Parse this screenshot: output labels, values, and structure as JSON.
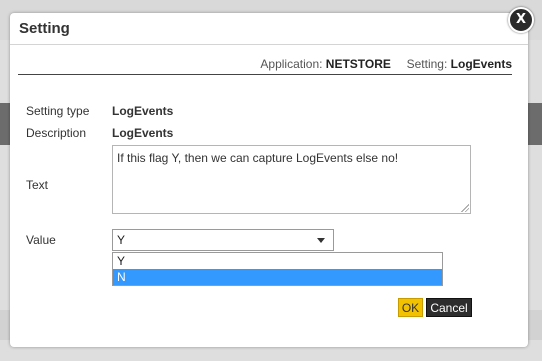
{
  "dialog": {
    "title": "Setting",
    "close_glyph": "X",
    "close_icon": "close-icon"
  },
  "context": {
    "application_label": "Application:",
    "application_value": "NETSTORE",
    "setting_label": "Setting:",
    "setting_value": "LogEvents"
  },
  "form": {
    "setting_type_label": "Setting type",
    "setting_type_value": "LogEvents",
    "description_label": "Description",
    "description_value": "LogEvents",
    "text_label": "Text",
    "text_value": "If this flag Y, then we can capture LogEvents else no!",
    "value_label": "Value",
    "value_selected": "Y",
    "value_options": [
      {
        "label": "Y",
        "highlighted": false
      },
      {
        "label": "N",
        "highlighted": true
      }
    ]
  },
  "buttons": {
    "ok_label": "OK",
    "cancel_label": "Cancel"
  },
  "colors": {
    "ok_button": "#f2c200",
    "cancel_button": "#2d2d2d",
    "option_highlight": "#3399ff",
    "overlay_background": "#dedede"
  }
}
